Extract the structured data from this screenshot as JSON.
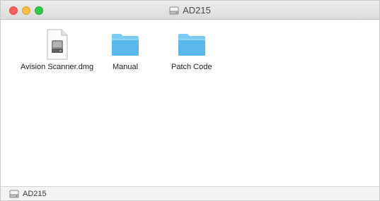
{
  "window": {
    "title": "AD215",
    "title_icon": "disk-image-icon"
  },
  "items": [
    {
      "label": "Avision Scanner.dmg",
      "icon": "dmg-file-icon"
    },
    {
      "label": "Manual",
      "icon": "folder-icon"
    },
    {
      "label": "Patch Code",
      "icon": "folder-icon"
    }
  ],
  "statusbar": {
    "path_label": "AD215",
    "path_icon": "disk-image-icon"
  },
  "colors": {
    "folder_top": "#7ccbf2",
    "folder_body": "#5bb8ea",
    "close": "#fc605c",
    "minimize": "#fdbc40",
    "maximize": "#34c84a"
  }
}
